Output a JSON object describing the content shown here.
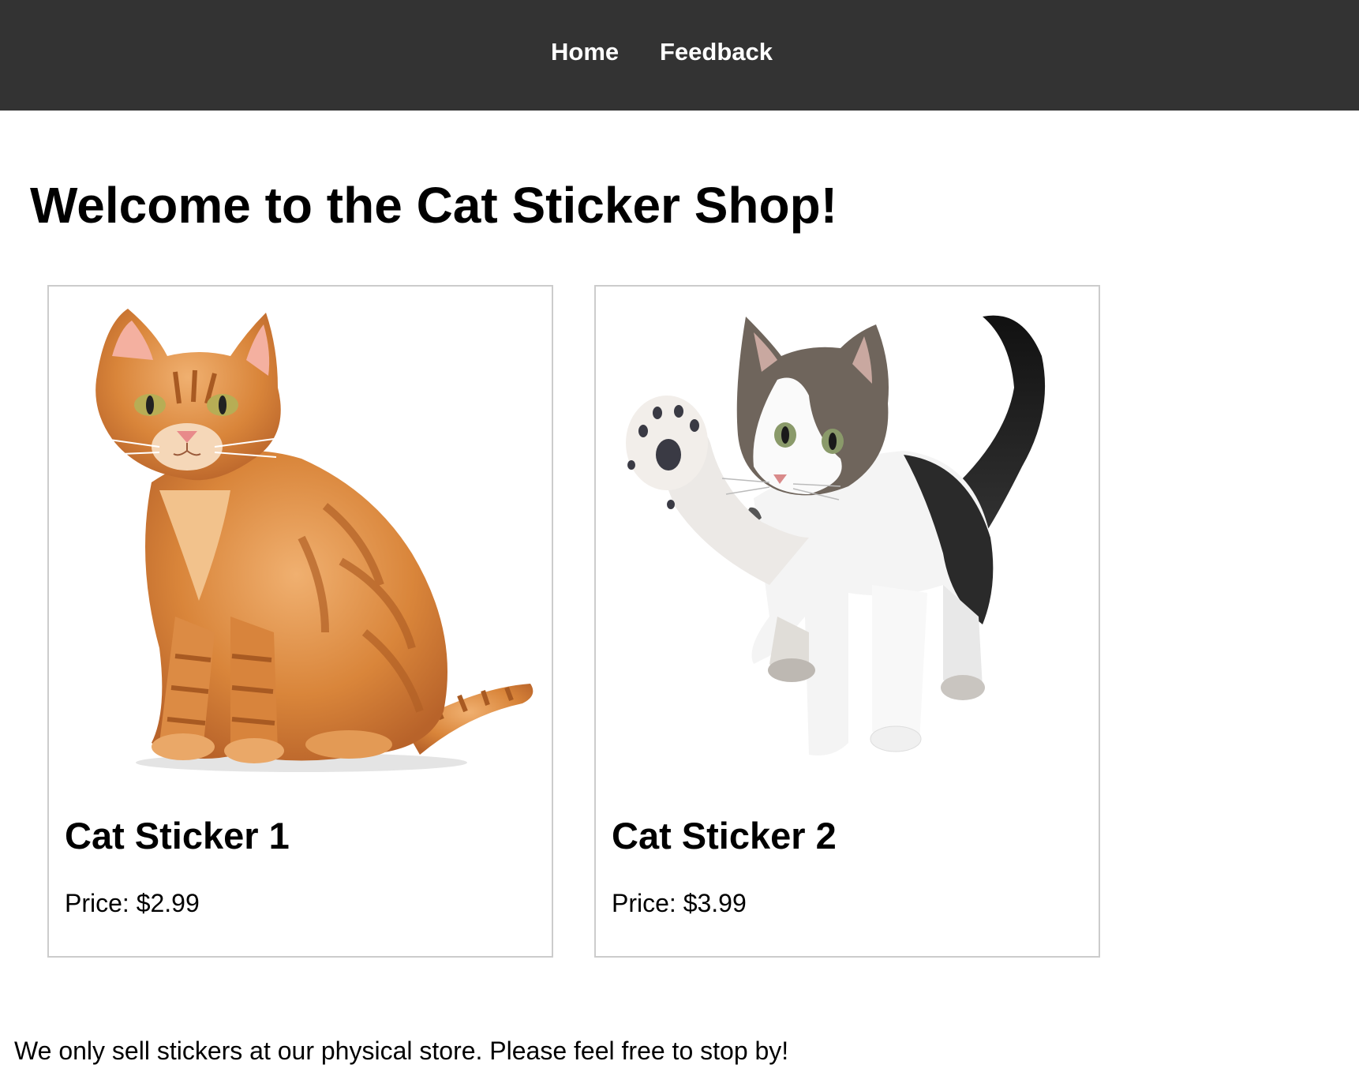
{
  "nav": {
    "items": [
      {
        "label": "Home"
      },
      {
        "label": "Feedback"
      }
    ]
  },
  "main": {
    "title": "Welcome to the Cat Sticker Shop!",
    "products": [
      {
        "name": "Cat Sticker 1",
        "price": "Price: $2.99",
        "image": "orange-tabby-cat-sitting"
      },
      {
        "name": "Cat Sticker 2",
        "price": "Price: $3.99",
        "image": "white-brown-kitten-raising-paw"
      }
    ]
  },
  "footer": {
    "note": "We only sell stickers at our physical store. Please feel free to stop by!"
  },
  "colors": {
    "nav_background": "#333333",
    "nav_text": "#ffffff",
    "card_border": "#cccccc"
  }
}
